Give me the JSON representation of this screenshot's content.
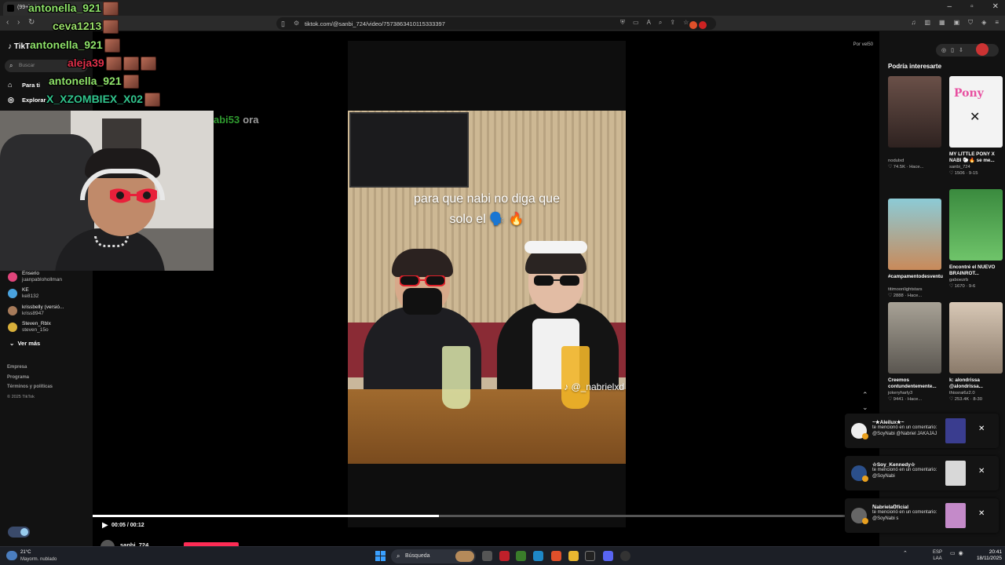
{
  "browser": {
    "tab_title": "(99+) Vi...",
    "url": "tiktok.com/@sanbi_724/video/7573863410115333397"
  },
  "sidebar": {
    "logo": "TikTok",
    "search_placeholder": "Buscar",
    "nav": [
      {
        "label": "Para ti",
        "icon": "home-icon"
      },
      {
        "label": "Explorar",
        "icon": "compass-icon"
      }
    ],
    "following": [
      {
        "name": "Enserio",
        "user": "juanpablohollman",
        "color": "#e0457b"
      },
      {
        "name": "KE",
        "user": "ke8132",
        "color": "#4aa3df"
      },
      {
        "name": "krissbelly (versió...",
        "user": "kriss8947",
        "color": "#a77b5a"
      },
      {
        "name": "Steven_Rblx",
        "user": "steven_15o",
        "color": "#d9b03a"
      }
    ],
    "see_more": "Ver más",
    "footer": [
      "Empresa",
      "Programa",
      "Términos y políticas"
    ],
    "copyright": "© 2025 TikTok"
  },
  "video": {
    "caption_line1": "para que nabi no diga que",
    "caption_line2": "solo el 🗣️ 🔥",
    "watermark": "♪ @_nabrielxd",
    "top_label": "Por vel50",
    "time": "00:05 / 00:12",
    "progress": 0.44,
    "author": "sanbi_724"
  },
  "right": {
    "title": "Podría interesarte",
    "cards": [
      {
        "title": "",
        "user": "nodulxd",
        "stats": "♡ 74.5K · Hace...",
        "thumb": "#6a5048"
      },
      {
        "title": "MY LITTLE PONY X NABI 🐑🔥 se me...",
        "user": "sanbi_724",
        "stats": "♡ 1506 · 9-15",
        "thumb": "#f3f3f3"
      },
      {
        "title": "#campamentodesventura2temp...",
        "user": "titimoonlightstars",
        "stats": "♡ 2888 · Hace...",
        "thumb": "#8ccbd6"
      },
      {
        "title": "Encontré el NUEVO BRAINROT...",
        "user": "gaboezrb",
        "stats": "♡ 1670 · 9-6",
        "thumb": "#4caf50"
      },
      {
        "title": "Creemos contundentemente...",
        "user": "jokeryharly3",
        "stats": "♡ 9441 · Hace...",
        "thumb": "#8f8a80"
      },
      {
        "title": "k: alondrissa @alondrissa...",
        "user": "thissrai6z2.0",
        "stats": "♡ 253.4K · 8-30",
        "thumb": "#b7a89a"
      }
    ]
  },
  "notifications": [
    {
      "name": "~★Aleilux★~",
      "text": "te mencionó en un comentario: @SoyNabi @Nabriel JAKAJAJ",
      "thumb": "#3a3d8f"
    },
    {
      "name": "☆Soy_Kennedy☆",
      "text": "te mencionó en un comentario: @SoyNabi",
      "thumb": "#d8d8d8"
    },
    {
      "name": "ℕabriela𝕆ficial",
      "text": "te mencionó en un comentario: @SoyNabi s",
      "thumb": "#c48ac9"
    }
  ],
  "chat": [
    {
      "user": "antonella_921",
      "color": "#8fe36a",
      "emotes": 1
    },
    {
      "user": "ceva1213",
      "color": "#9be06a",
      "emotes": 1
    },
    {
      "user": "antonella_921",
      "color": "#8fe36a",
      "emotes": 1
    },
    {
      "user": "aleja39",
      "color": "#e0304a",
      "emotes": 3
    },
    {
      "user": "antonella_921",
      "color": "#8fe36a",
      "emotes": 1
    },
    {
      "user": "X_XZOMBIEX_X02",
      "color": "#31c48d",
      "emotes": 1
    }
  ],
  "chat_extra": {
    "user": "abi53",
    "msg": "ora"
  },
  "taskbar": {
    "temp": "21°C",
    "weather": "Mayorm. nublado",
    "search": "Búsqueda",
    "lang1": "ESP",
    "lang2": "LAA",
    "time": "20:41",
    "date": "18/11/2025"
  },
  "colors": {
    "accent": "#fe2c55",
    "bg": "#121212"
  }
}
